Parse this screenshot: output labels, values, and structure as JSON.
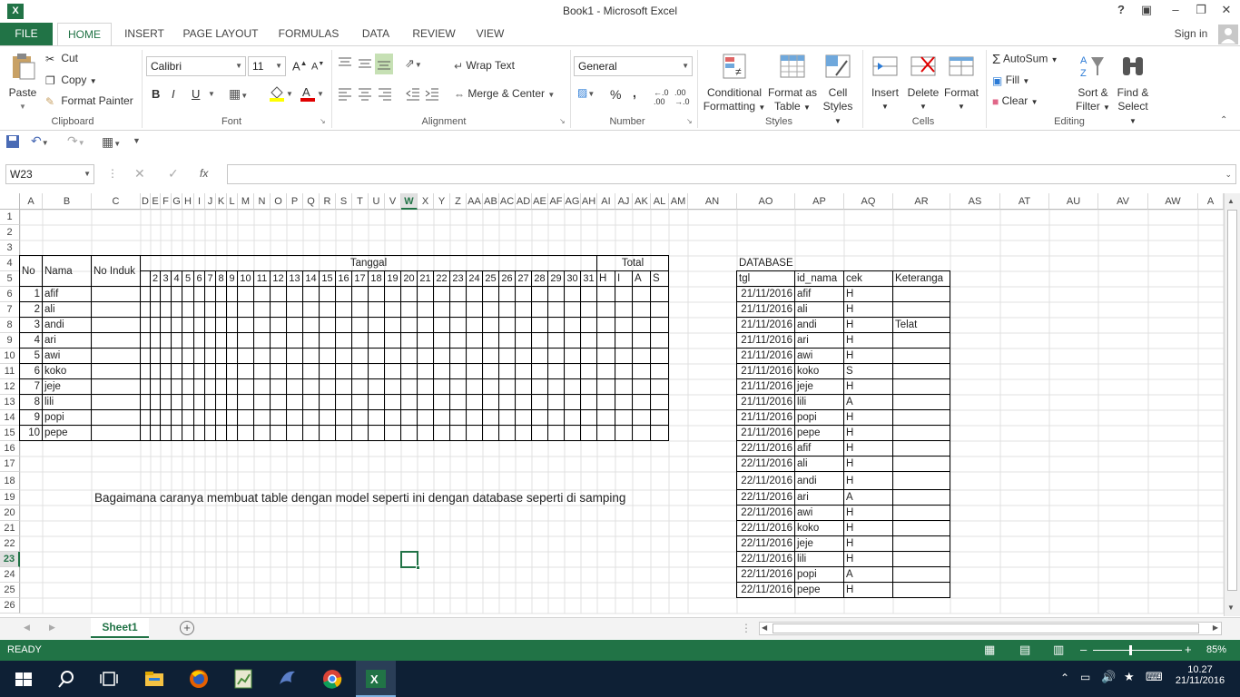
{
  "window": {
    "title": "Book1 - Microsoft Excel",
    "signin": "Sign in",
    "help": "?"
  },
  "tabs": [
    {
      "label": "FILE"
    },
    {
      "label": "HOME"
    },
    {
      "label": "INSERT"
    },
    {
      "label": "PAGE LAYOUT"
    },
    {
      "label": "FORMULAS"
    },
    {
      "label": "DATA"
    },
    {
      "label": "REVIEW"
    },
    {
      "label": "VIEW"
    }
  ],
  "ribbon": {
    "clipboard": {
      "label": "Clipboard",
      "paste": "Paste",
      "cut": "Cut",
      "copy": "Copy",
      "format_painter": "Format Painter"
    },
    "font": {
      "label": "Font",
      "name": "Calibri",
      "size": "11",
      "bold": "B",
      "italic": "I",
      "underline": "U"
    },
    "alignment": {
      "label": "Alignment",
      "wrap": "Wrap Text",
      "merge": "Merge & Center"
    },
    "number": {
      "label": "Number",
      "format": "General",
      "percent": "%",
      "comma": ","
    },
    "styles": {
      "label": "Styles",
      "conditional": "Conditional",
      "conditional2": "Formatting",
      "format_table": "Format as",
      "format_table2": "Table",
      "cell_styles": "Cell",
      "cell_styles2": "Styles"
    },
    "cells": {
      "label": "Cells",
      "insert": "Insert",
      "delete": "Delete",
      "format": "Format"
    },
    "editing": {
      "label": "Editing",
      "autosum": "AutoSum",
      "fill": "Fill",
      "clear": "Clear",
      "sort": "Sort &",
      "sort2": "Filter",
      "find": "Find &",
      "find2": "Select"
    }
  },
  "formula_bar": {
    "name_box": "W23",
    "fx": "fx",
    "content": ""
  },
  "columns": [
    "A",
    "B",
    "C",
    "D",
    "E",
    "F",
    "G",
    "H",
    "I",
    "J",
    "K",
    "L",
    "M",
    "N",
    "O",
    "P",
    "Q",
    "R",
    "S",
    "T",
    "U",
    "V",
    "W",
    "X",
    "Y",
    "Z",
    "AA",
    "AB",
    "AC",
    "AD",
    "AE",
    "AF",
    "AG",
    "AH",
    "AI",
    "AJ",
    "AK",
    "AL",
    "AM",
    "AN",
    "AO",
    "AP",
    "AQ",
    "AR",
    "AS",
    "AT",
    "AU",
    "AV",
    "AW",
    "A"
  ],
  "rows": [
    "1",
    "2",
    "3",
    "4",
    "5",
    "6",
    "7",
    "8",
    "9",
    "10",
    "11",
    "12",
    "13",
    "14",
    "15",
    "16",
    "17",
    "18",
    "19",
    "20",
    "21",
    "22",
    "23",
    "24",
    "25",
    "26"
  ],
  "attendance": {
    "header": {
      "no": "No",
      "nama": "Nama",
      "no_induk": "No Induk",
      "tanggal": "Tanggal",
      "total": "Total"
    },
    "dates": [
      "2",
      "3",
      "4",
      "5",
      "6",
      "7",
      "8",
      "9",
      "10",
      "11",
      "12",
      "13",
      "14",
      "15",
      "16",
      "17",
      "18",
      "19",
      "20",
      "21",
      "22",
      "23",
      "24",
      "25",
      "26",
      "27",
      "28",
      "29",
      "30",
      "31"
    ],
    "totals": [
      "H",
      "I",
      "A",
      "S"
    ],
    "students": [
      {
        "no": "1",
        "nama": "afif"
      },
      {
        "no": "2",
        "nama": "ali"
      },
      {
        "no": "3",
        "nama": "andi"
      },
      {
        "no": "4",
        "nama": "ari"
      },
      {
        "no": "5",
        "nama": "awi"
      },
      {
        "no": "6",
        "nama": "koko"
      },
      {
        "no": "7",
        "nama": "jeje"
      },
      {
        "no": "8",
        "nama": "lili"
      },
      {
        "no": "9",
        "nama": "popi"
      },
      {
        "no": "10",
        "nama": "pepe"
      }
    ]
  },
  "question": "Bagaimana caranya membuat table dengan model seperti ini dengan database seperti di samping",
  "database": {
    "title": "DATABASE",
    "headers": [
      "tgl",
      "id_nama",
      "cek",
      "Keteranga"
    ],
    "rows": [
      [
        "21/11/2016",
        "afif",
        "H",
        ""
      ],
      [
        "21/11/2016",
        "ali",
        "H",
        ""
      ],
      [
        "21/11/2016",
        "andi",
        "H",
        "Telat"
      ],
      [
        "21/11/2016",
        "ari",
        "H",
        ""
      ],
      [
        "21/11/2016",
        "awi",
        "H",
        ""
      ],
      [
        "21/11/2016",
        "koko",
        "S",
        ""
      ],
      [
        "21/11/2016",
        "jeje",
        "H",
        ""
      ],
      [
        "21/11/2016",
        "lili",
        "A",
        ""
      ],
      [
        "21/11/2016",
        "popi",
        "H",
        ""
      ],
      [
        "21/11/2016",
        "pepe",
        "H",
        ""
      ],
      [
        "22/11/2016",
        "afif",
        "H",
        ""
      ],
      [
        "22/11/2016",
        "ali",
        "H",
        ""
      ],
      [
        "22/11/2016",
        "andi",
        "H",
        ""
      ],
      [
        "22/11/2016",
        "ari",
        "A",
        ""
      ],
      [
        "22/11/2016",
        "awi",
        "H",
        ""
      ],
      [
        "22/11/2016",
        "koko",
        "H",
        ""
      ],
      [
        "22/11/2016",
        "jeje",
        "H",
        ""
      ],
      [
        "22/11/2016",
        "lili",
        "H",
        ""
      ],
      [
        "22/11/2016",
        "popi",
        "A",
        ""
      ],
      [
        "22/11/2016",
        "pepe",
        "H",
        ""
      ]
    ]
  },
  "sheet": {
    "tab": "Sheet1",
    "add": "+"
  },
  "status": {
    "ready": "READY",
    "zoom": "85%"
  },
  "taskbar": {
    "time": "10.27",
    "date": "21/11/2016"
  },
  "colors": {
    "accent": "#217346",
    "taskbar": "#0e2035"
  }
}
